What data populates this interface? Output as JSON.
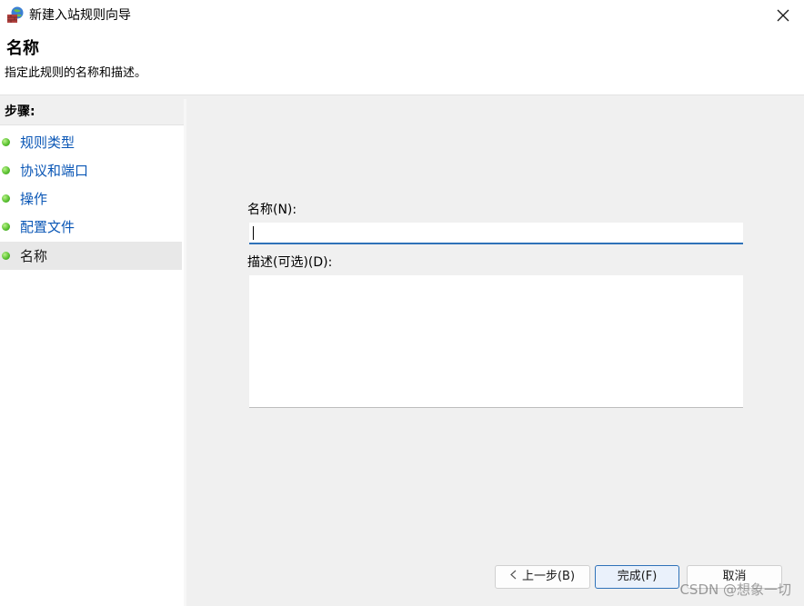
{
  "window": {
    "title": "新建入站规则向导",
    "icon": "firewall-icon"
  },
  "header": {
    "title": "名称",
    "subtitle": "指定此规则的名称和描述。"
  },
  "sidebar": {
    "heading": "步骤:",
    "items": [
      {
        "label": "规则类型",
        "current": false
      },
      {
        "label": "协议和端口",
        "current": false
      },
      {
        "label": "操作",
        "current": false
      },
      {
        "label": "配置文件",
        "current": false
      },
      {
        "label": "名称",
        "current": true
      }
    ]
  },
  "form": {
    "name_label": "名称(N):",
    "name_value": "",
    "description_label": "描述(可选)(D):",
    "description_value": ""
  },
  "buttons": {
    "back": "上一步(B)",
    "finish": "完成(F)",
    "cancel": "取消"
  },
  "watermark": "CSDN @想象一切",
  "colors": {
    "link": "#0b57b6",
    "accent": "#2f72b8",
    "step_dot": "#5cc232"
  }
}
